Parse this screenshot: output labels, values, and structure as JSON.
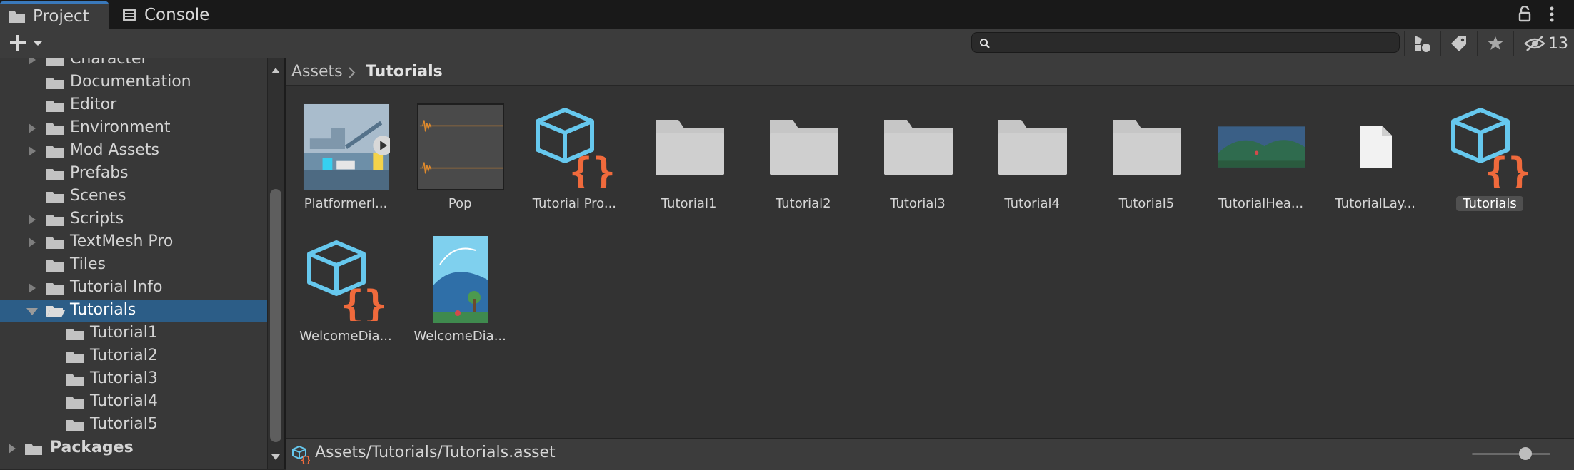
{
  "tabs": [
    {
      "label": "Project",
      "icon": "folder-icon",
      "active": true
    },
    {
      "label": "Console",
      "icon": "console-icon",
      "active": false
    }
  ],
  "toolbar": {
    "create_icon": "plus-icon",
    "search_placeholder": "",
    "hidden_count": "13"
  },
  "tree": {
    "items": [
      {
        "label": "Character",
        "expandable": true,
        "indent": 0
      },
      {
        "label": "Documentation",
        "expandable": false,
        "indent": 0
      },
      {
        "label": "Editor",
        "expandable": false,
        "indent": 0
      },
      {
        "label": "Environment",
        "expandable": true,
        "indent": 0
      },
      {
        "label": "Mod Assets",
        "expandable": true,
        "indent": 0
      },
      {
        "label": "Prefabs",
        "expandable": false,
        "indent": 0
      },
      {
        "label": "Scenes",
        "expandable": false,
        "indent": 0
      },
      {
        "label": "Scripts",
        "expandable": true,
        "indent": 0
      },
      {
        "label": "TextMesh Pro",
        "expandable": true,
        "indent": 0
      },
      {
        "label": "Tiles",
        "expandable": false,
        "indent": 0
      },
      {
        "label": "Tutorial Info",
        "expandable": true,
        "indent": 0
      },
      {
        "label": "Tutorials",
        "expandable": true,
        "expanded": true,
        "selected": true,
        "indent": 0
      },
      {
        "label": "Tutorial1",
        "expandable": false,
        "indent": 1
      },
      {
        "label": "Tutorial2",
        "expandable": false,
        "indent": 1
      },
      {
        "label": "Tutorial3",
        "expandable": false,
        "indent": 1
      },
      {
        "label": "Tutorial4",
        "expandable": false,
        "indent": 1
      },
      {
        "label": "Tutorial5",
        "expandable": false,
        "indent": 1
      }
    ],
    "packages_label": "Packages"
  },
  "breadcrumb": {
    "root": "Assets",
    "current": "Tutorials"
  },
  "assets": [
    {
      "label": "Platformerl...",
      "type": "video"
    },
    {
      "label": "Pop",
      "type": "audio"
    },
    {
      "label": "Tutorial Pro...",
      "type": "script-object"
    },
    {
      "label": "Tutorial1",
      "type": "folder"
    },
    {
      "label": "Tutorial2",
      "type": "folder"
    },
    {
      "label": "Tutorial3",
      "type": "folder"
    },
    {
      "label": "Tutorial4",
      "type": "folder"
    },
    {
      "label": "Tutorial5",
      "type": "folder"
    },
    {
      "label": "TutorialHea...",
      "type": "image-wide"
    },
    {
      "label": "TutorialLay...",
      "type": "file"
    },
    {
      "label": "Tutorials",
      "type": "script-object",
      "selected": true
    },
    {
      "label": "WelcomeDia...",
      "type": "script-object"
    },
    {
      "label": "WelcomeDia...",
      "type": "image-tall"
    }
  ],
  "status": {
    "path": "Assets/Tutorials/Tutorials.asset",
    "zoom_level": 0.68
  },
  "colors": {
    "selection": "#2c5d87",
    "tab_accent": "#3a79bb",
    "script_cube": "#66c8ee",
    "script_braces": "#f06a3c"
  }
}
